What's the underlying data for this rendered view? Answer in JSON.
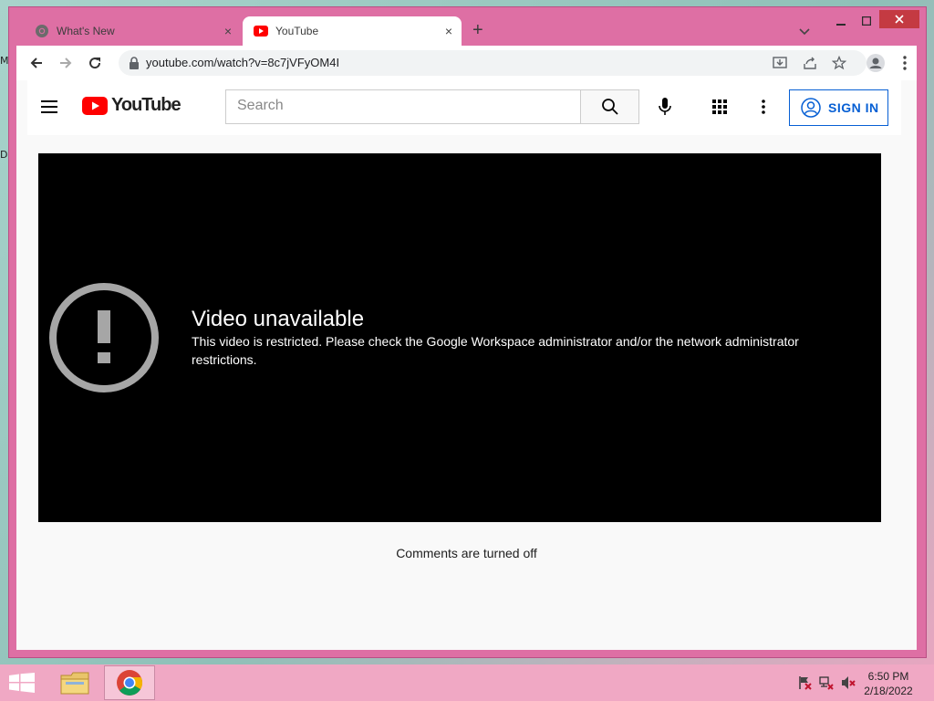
{
  "browser": {
    "tabs": [
      {
        "title": "What's New",
        "icon": "chrome-icon",
        "close": "×"
      },
      {
        "title": "YouTube",
        "icon": "youtube-icon",
        "close": "×"
      }
    ],
    "new_tab": "+",
    "url": "youtube.com/watch?v=8c7jVFyOM4I"
  },
  "youtube": {
    "logo_text": "YouTube",
    "search_placeholder": "Search",
    "sign_in": "SIGN IN",
    "error_title": "Video unavailable",
    "error_message": "This video is restricted. Please check the Google Workspace administrator and/or the network administrator restrictions.",
    "comments_status": "Comments are turned off"
  },
  "taskbar": {
    "time": "6:50 PM",
    "date": "2/18/2022"
  },
  "desktop": {
    "edge_letters": [
      "M",
      "D"
    ]
  },
  "colors": {
    "window_frame": "#de6fa4",
    "youtube_red": "#ff0000",
    "signin_blue": "#065fd4",
    "close_red": "#c43a42",
    "taskbar": "#f0a8c4"
  }
}
